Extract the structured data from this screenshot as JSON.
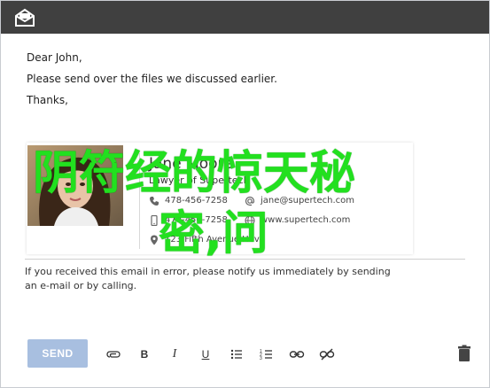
{
  "email": {
    "greeting": "Dear John,",
    "line1": "Please send over the files we discussed earlier.",
    "closing": "Thanks,"
  },
  "signature": {
    "name": "Jane Moore",
    "title": "Lawyer of Supertech",
    "phone": "478-456-7258",
    "mobile": "478-456-7258",
    "address": "123 Fifth Avenue Heve",
    "email": "jane@supertech.com",
    "website": "www.supertech.com"
  },
  "overlay": {
    "line1": "阴符经的惊天秘",
    "line2": "密,问"
  },
  "disclaimer": "If you received this email in error, please notify us immediately by sending an e-mail or by calling.",
  "toolbar": {
    "send_label": "SEND"
  },
  "colors": {
    "titlebar": "#404040",
    "send_button": "#a8bfe0",
    "overlay_text": "#22e01f"
  }
}
